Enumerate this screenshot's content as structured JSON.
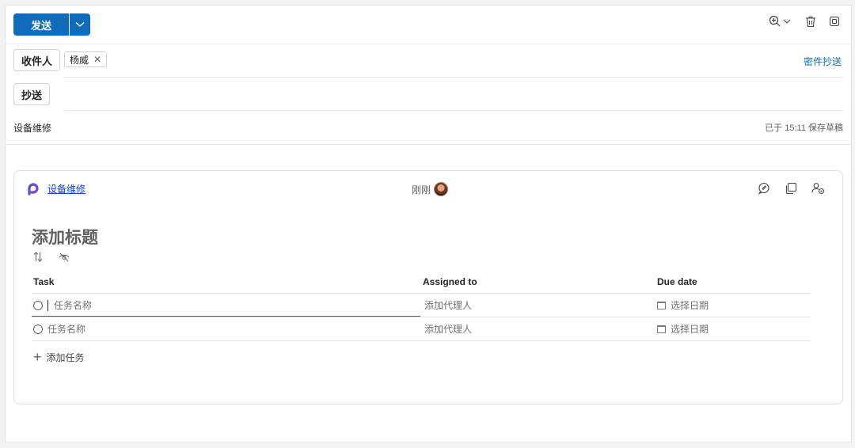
{
  "toolbar": {
    "send_label": "发送",
    "icons": [
      "zoom-in-icon",
      "chevron-down-icon",
      "delete-icon",
      "popout-icon"
    ]
  },
  "recipients": {
    "to_label": "收件人",
    "to_chip": "杨威",
    "bcc_link": "密件抄送",
    "cc_label": "抄送"
  },
  "subject": "设备维修",
  "draft_status": "已于 15:11 保存草稿",
  "loop": {
    "title_link": "设备维修",
    "time_label": "刚刚",
    "task_title_placeholder": "添加标题",
    "columns": {
      "task": "Task",
      "assigned": "Assigned to",
      "due": "Due date"
    },
    "rows": [
      {
        "task": "任务名称",
        "assigned": "添加代理人",
        "due": "选择日期"
      },
      {
        "task": "任务名称",
        "assigned": "添加代理人",
        "due": "选择日期"
      }
    ],
    "add_task": "添加任务"
  },
  "colors": {
    "accent": "#0f6cbd",
    "link": "#0f3ddb"
  }
}
